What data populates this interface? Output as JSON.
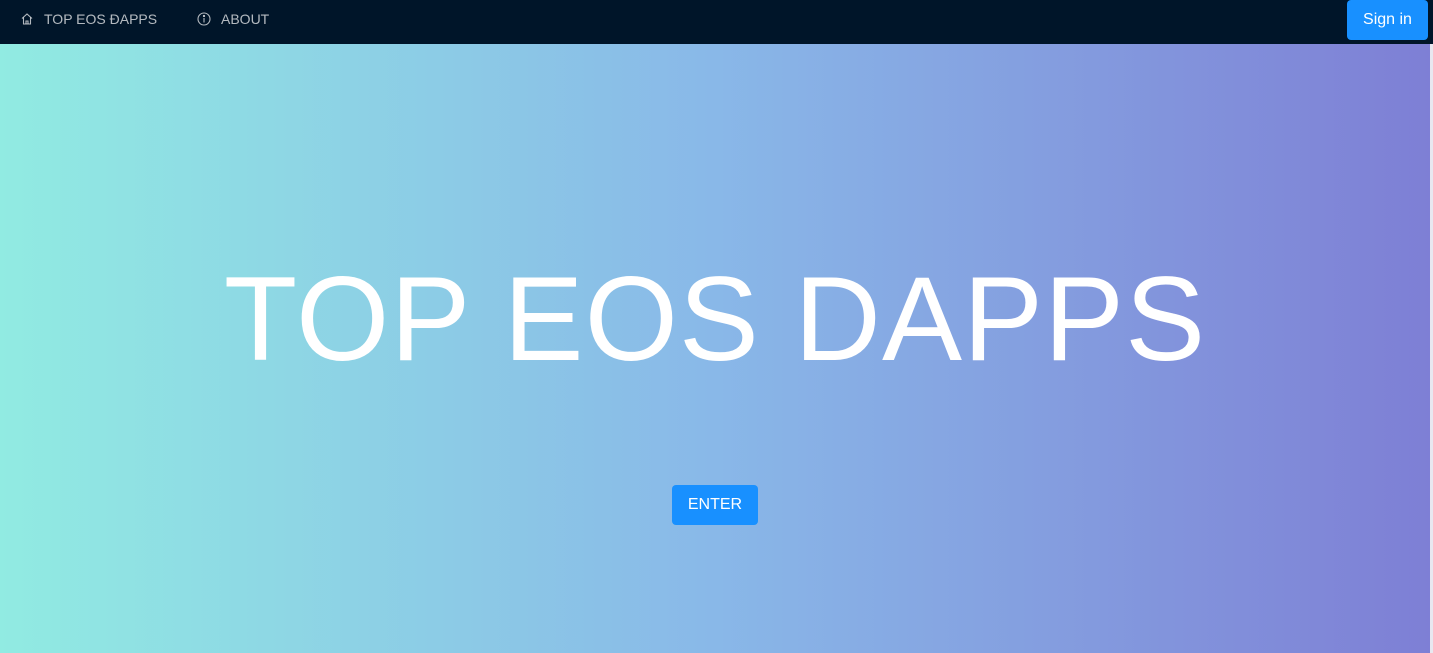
{
  "nav": {
    "items": [
      {
        "label": "TOP EOS ĐAPPS",
        "icon": "home-icon"
      },
      {
        "label": "ABOUT",
        "icon": "info-circle-icon"
      }
    ],
    "signin_label": "Sign in"
  },
  "hero": {
    "title": "TOP EOS DAPPS",
    "enter_label": "ENTER"
  },
  "colors": {
    "navbar_bg": "#001529",
    "primary": "#1890ff",
    "gradient_start": "#91ebe2",
    "gradient_mid": "#89b8e8",
    "gradient_end": "#7e7fd5"
  }
}
